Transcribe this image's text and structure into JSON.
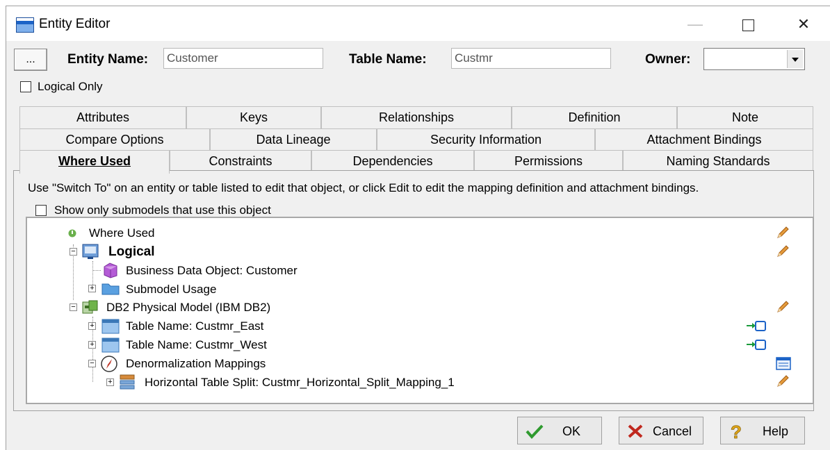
{
  "window": {
    "title": "Entity Editor"
  },
  "header": {
    "dots_label": "...",
    "entity_name_label": "Entity Name:",
    "entity_name_value": "Customer",
    "table_name_label": "Table Name:",
    "table_name_value": "Custmr",
    "owner_label": "Owner:",
    "owner_value": "",
    "logical_only_label": "Logical Only"
  },
  "tabs": {
    "row1": [
      "Attributes",
      "Keys",
      "Relationships",
      "Definition",
      "Note"
    ],
    "row2": [
      "Compare Options",
      "Data Lineage",
      "Security Information",
      "Attachment Bindings"
    ],
    "row3": [
      "Where Used",
      "Constraints",
      "Dependencies",
      "Permissions",
      "Naming Standards"
    ],
    "active": "Where Used"
  },
  "where_used": {
    "info": "Use \"Switch To\" on an entity or table listed to edit that object, or click Edit to edit the mapping definition and attachment bindings.",
    "show_only_label": "Show only submodels that use this object",
    "tree": [
      "Where Used",
      "Logical",
      "Business Data Object: Customer",
      "Submodel Usage",
      "DB2 Physical Model (IBM DB2)",
      "Table Name: Custmr_East",
      "Table Name: Custmr_West",
      "Denormalization Mappings",
      "Horizontal Table Split: Custmr_Horizontal_Split_Mapping_1"
    ]
  },
  "buttons": {
    "ok": "OK",
    "cancel": "Cancel",
    "help": "Help"
  },
  "colors": {
    "window_bg": "#f0f0f0",
    "accent_blue": "#1c63c7",
    "pencil_orange": "#d9822b"
  }
}
